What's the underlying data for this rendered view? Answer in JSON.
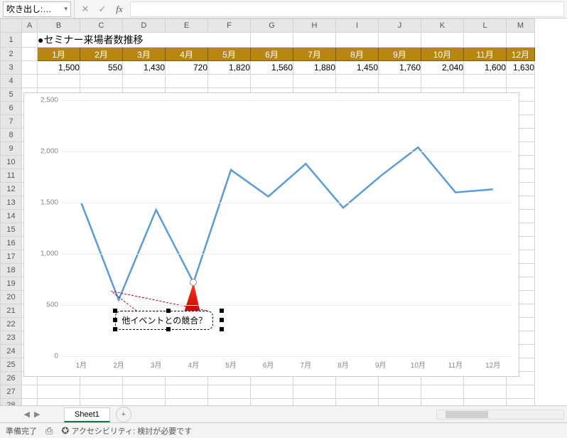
{
  "formula_bar": {
    "namebox": "吹き出し:…",
    "namebox_arrow": "▾",
    "cancel": "✕",
    "confirm": "✓",
    "fx": "fx"
  },
  "columns": [
    "A",
    "B",
    "C",
    "D",
    "E",
    "F",
    "G",
    "H",
    "I",
    "J",
    "K",
    "L",
    "M"
  ],
  "row_count": 29,
  "title": "●セミナー来場者数推移",
  "months": [
    "1月",
    "2月",
    "3月",
    "4月",
    "5月",
    "6月",
    "7月",
    "8月",
    "9月",
    "10月",
    "11月",
    "12月"
  ],
  "values_display": [
    "1,500",
    "550",
    "1,430",
    "720",
    "1,820",
    "1,560",
    "1,880",
    "1,450",
    "1,760",
    "2,040",
    "1,600",
    "1,630"
  ],
  "callout_text": "他イベントとの競合？",
  "tabs": {
    "sheet": "Sheet1",
    "add": "+"
  },
  "status": {
    "ready": "準備完了",
    "rec_icon": "⎙",
    "acc_icon": "✪",
    "accessibility": "アクセシビリティ: 検討が必要です"
  },
  "chart_data": {
    "type": "line",
    "categories": [
      "1月",
      "2月",
      "3月",
      "4月",
      "5月",
      "6月",
      "7月",
      "8月",
      "9月",
      "10月",
      "11月",
      "12月"
    ],
    "values": [
      1500,
      550,
      1430,
      720,
      1820,
      1560,
      1880,
      1450,
      1760,
      2040,
      1600,
      1630
    ],
    "title": "",
    "xlabel": "",
    "ylabel": "",
    "ylim": [
      0,
      2500
    ],
    "yticks": [
      0,
      500,
      1000,
      1500,
      2000,
      2500
    ],
    "annotations": [
      {
        "text": "他イベントとの競合？",
        "near_x": "4月"
      }
    ]
  }
}
